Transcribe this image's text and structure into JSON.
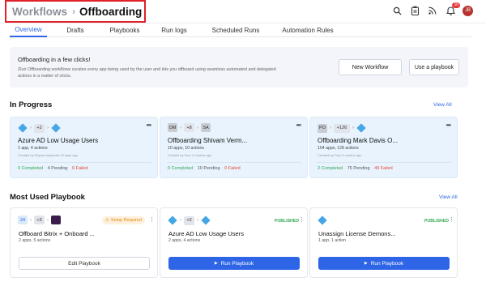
{
  "header": {
    "breadcrumb_root": "Workflows",
    "breadcrumb_sep": "›",
    "breadcrumb_current": "Offboarding",
    "icons": [
      "search-icon",
      "clipboard-icon",
      "rss-icon",
      "bell-icon"
    ],
    "notification_count": "10",
    "avatar_initials": "JB"
  },
  "tabs": [
    "Overview",
    "Drafts",
    "Playbooks",
    "Run logs",
    "Scheduled Runs",
    "Automation Rules"
  ],
  "banner": {
    "title": "Offboarding in a few clicks!",
    "description": "Zluri Offboarding workflows curates every app being used by the user and lets you offboard using seamless automated and delegated actions in a matter of clicks.",
    "new_workflow": "New Workflow",
    "use_playbook": "Use a playbook"
  },
  "in_progress": {
    "title": "In Progress",
    "view_all": "View All",
    "cards": [
      {
        "extra": "+2",
        "title": "Azure AD Low Usage Users",
        "sub": "1 app, 4 actions",
        "by": "Created by Shyam Aadarsha 23 days ago",
        "completed": "0 Completed",
        "pending": "4 Pending",
        "failed": "0 Failed",
        "avatars": [],
        "icon": "azure-icon"
      },
      {
        "extra": "+8",
        "title": "Offboarding Shivam Verm...",
        "sub": "10 apps, 10 actions",
        "by": "Created by Zorn 3 months ago",
        "completed": "0 Completed",
        "pending": "10 Pending",
        "failed": "0 Failed",
        "avatars": [
          "OM",
          "SA"
        ]
      },
      {
        "extra": "+126",
        "title": "Offboarding Mark Davis O...",
        "sub": "104 apps, 128 actions",
        "by": "Created by Tony 8 months ago",
        "completed": "2 Completed",
        "pending": "76 Pending",
        "failed": "49 Failed",
        "avatars": [
          "PO"
        ]
      }
    ]
  },
  "most_used": {
    "title": "Most Used Playbook",
    "view_all": "View All",
    "cards": [
      {
        "title": "Offboard Bitrix + Onboard ...",
        "sub": "2 apps, 5 actions",
        "tag": "Setup Required",
        "extra": "+3",
        "button": "Edit Playbook"
      },
      {
        "title": "Azure AD Low Usage Users",
        "sub": "2 apps, 4 actions",
        "tag": "PUBLISHED",
        "extra": "+2",
        "button": "Run Playbook"
      },
      {
        "title": "Unassign License Demons...",
        "sub": "1 app, 1 action",
        "tag": "PUBLISHED",
        "button": "Run Playbook"
      }
    ]
  },
  "colors": {
    "accent": "#2e64e6",
    "highlight_box": "#e0202a",
    "card_bg": "#e8f3fd",
    "success": "#33a853",
    "fail": "#e5483b",
    "warning": "#e48a12"
  }
}
